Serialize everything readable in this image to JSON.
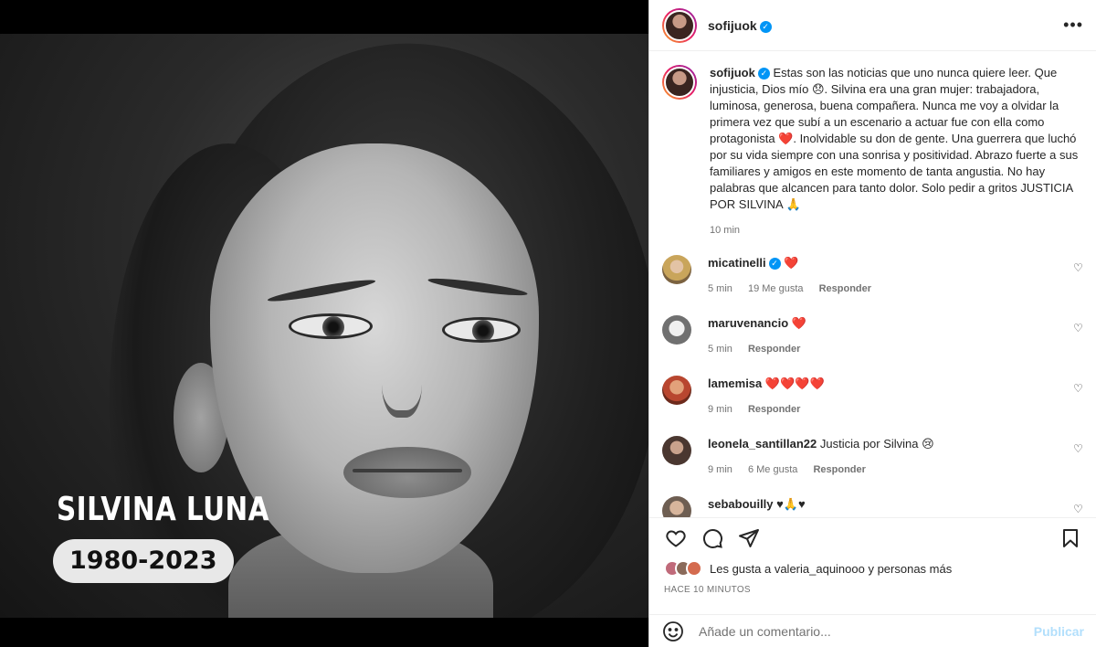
{
  "media": {
    "memorial_name": "SILVINA LUNA",
    "memorial_years": "1980-2023"
  },
  "post": {
    "author": "sofijuok",
    "more_icon": "ellipsis-icon",
    "caption": {
      "username": "sofijuok",
      "text": "Estas son las noticias que uno nunca quiere leer. Que injusticia, Dios mío 😞. Silvina era una gran mujer: trabajadora, luminosa, generosa, buena compañera. Nunca me voy a olvidar la primera vez que subí a un escenario a actuar fue con ella como protagonista ❤️. Inolvidable su don de gente. Una guerrera que luchó por su vida siempre con una sonrisa y positividad. Abrazo fuerte a sus familiares y amigos en este momento de tanta angustia. No hay palabras que alcancen para tanto dolor. Solo pedir a gritos JUSTICIA POR SILVINA 🙏",
      "time": "10 min"
    },
    "comments": [
      {
        "username": "micatinelli",
        "verified": true,
        "text": "❤️",
        "time": "5 min",
        "likes": "19 Me gusta",
        "reply": "Responder"
      },
      {
        "username": "maruvenancio",
        "verified": false,
        "text": "❤️",
        "time": "5 min",
        "likes": "",
        "reply": "Responder"
      },
      {
        "username": "lamemisa",
        "verified": false,
        "text": "❤️❤️❤️❤️",
        "time": "9 min",
        "likes": "",
        "reply": "Responder"
      },
      {
        "username": "leonela_santillan22",
        "verified": false,
        "text": "Justicia por Silvina 😢",
        "time": "9 min",
        "likes": "6 Me gusta",
        "reply": "Responder"
      },
      {
        "username": "sebabouilly",
        "verified": false,
        "text": "♥🙏♥",
        "time": "",
        "likes": "",
        "reply": ""
      }
    ],
    "likes_text": "Les gusta a valeria_aquinooo y personas más",
    "timestamp": "HACE 10 MINUTOS",
    "comment_placeholder": "Añade un comentario...",
    "publish_label": "Publicar"
  },
  "colors": {
    "accent": "#0095f6",
    "heart_red": "#ed4956",
    "publish_disabled": "#b2dffc"
  }
}
